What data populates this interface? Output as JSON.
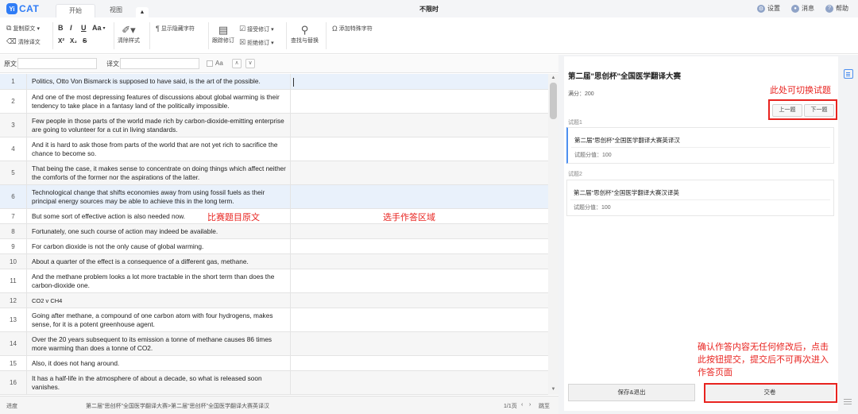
{
  "app": {
    "logo_badge": "Yi",
    "logo_text": "CAT",
    "document_title": "不限时"
  },
  "tabs": [
    {
      "label": "开始",
      "active": true
    },
    {
      "label": "视图",
      "active": false
    }
  ],
  "collapse_glyph": "▲",
  "titlebar_links": [
    {
      "label": "设置",
      "icon": "gear-icon",
      "glyph": "⚙"
    },
    {
      "label": "消息",
      "icon": "bell-icon",
      "glyph": "🔔"
    },
    {
      "label": "帮助",
      "icon": "help-icon",
      "glyph": "?"
    }
  ],
  "ribbon": {
    "copy_source": "复制原文",
    "clear_translation": "清除译文",
    "bold": "B",
    "italic": "I",
    "underline": "U",
    "font_case": "Aa",
    "superscript": "X²",
    "subscript": "X₂",
    "strikethrough": "S",
    "clear_format": "清除样式",
    "show_hidden": "显示隐藏字符",
    "track_changes": "跟踪修订",
    "accept_change": "接受修订",
    "reject_change": "拒绝修订",
    "find_replace": "查找与替换",
    "special_char": "添加特殊字符"
  },
  "search": {
    "source_label": "原文",
    "target_label": "译文",
    "match_case": "Aa",
    "prev": "∧",
    "next": "∨"
  },
  "segments": [
    {
      "num": "1",
      "source": "Politics, Otto Von Bismarck is supposed to have said, is the art of the possible."
    },
    {
      "num": "2",
      "source": "And one of the most depressing features of discussions about global warming is their tendency to take place in a fantasy land of the politically impossible."
    },
    {
      "num": "3",
      "source": "Few people in those parts of the world made rich by carbon-dioxide-emitting enterprise are going to volunteer for a cut in living standards."
    },
    {
      "num": "4",
      "source": "And it is hard to ask those from parts of the world that are not yet rich to sacrifice the chance to become so."
    },
    {
      "num": "5",
      "source": "That being the case, it makes sense to concentrate on doing things which affect neither the comforts of the former nor the aspirations of the latter."
    },
    {
      "num": "6",
      "source": "Technological change that shifts economies away from using fossil fuels as their principal energy sources may be able to achieve this in the long term."
    },
    {
      "num": "7",
      "source": "But some sort of effective action is also needed now."
    },
    {
      "num": "8",
      "source": "Fortunately, one such course of action may indeed be available."
    },
    {
      "num": "9",
      "source": "For carbon dioxide is not the only cause of global warming."
    },
    {
      "num": "10",
      "source": "About a quarter of the effect is a consequence of a different gas, methane."
    },
    {
      "num": "11",
      "source": "And the methane problem looks a lot more tractable in the short term than does the carbon-dioxide one."
    },
    {
      "num": "12",
      "source": "CO2 v CH4"
    },
    {
      "num": "13",
      "source": "Going after methane, a compound of one carbon atom with four hydrogens, makes sense, for it is a potent greenhouse agent."
    },
    {
      "num": "14",
      "source": "Over the 20 years subsequent to its emission a tonne of methane causes 86 times more warming than does a tonne of CO2."
    },
    {
      "num": "15",
      "source": "Also, it does not hang around."
    },
    {
      "num": "16",
      "source": "It has a half-life in the atmosphere of about a decade, so what is released soon vanishes."
    }
  ],
  "annotations": {
    "source_area": "比赛题目原文",
    "answer_area": "选手作答区域",
    "switch_question": "此处可切换试题",
    "submit_note_1": "确认作答内容无任何修改后，点击",
    "submit_note_2": "此按钮提交，提交后不可再次进入",
    "submit_note_3": "作答页面"
  },
  "status": {
    "progress_label": "进度",
    "path": "第二届\"思创杯\"全国医学翻译大赛>第二届\"思创杯\"全国医学翻译大赛英译汉",
    "page": "1/1页",
    "goto": "跳至"
  },
  "panel": {
    "title": "第二届\"思创杯\"全国医学翻译大赛",
    "total_score": "满分：200",
    "prev_button": "上一题",
    "next_button": "下一题",
    "questions": [
      {
        "label": "试题1",
        "title": "第二届\"思创杯\"全国医学翻译大赛英译汉",
        "score": "试题分值：100"
      },
      {
        "label": "试题2",
        "title": "第二届\"思创杯\"全国医学翻译大赛汉译英",
        "score": "试题分值：100"
      }
    ],
    "save_exit": "保存&退出",
    "submit": "交卷"
  }
}
